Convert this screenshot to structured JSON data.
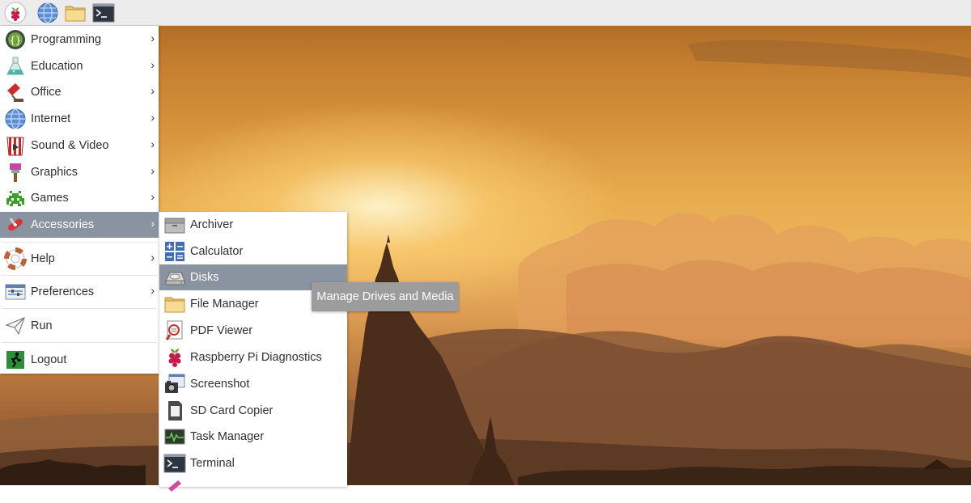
{
  "panel": {
    "buttons": [
      {
        "name": "raspberry-menu-button",
        "icon": "raspberry-icon"
      },
      {
        "name": "web-browser-button",
        "icon": "globe-icon"
      },
      {
        "name": "file-manager-button",
        "icon": "folder-icon"
      },
      {
        "name": "terminal-button",
        "icon": "terminal-icon"
      }
    ]
  },
  "main_menu": {
    "items": [
      {
        "label": "Programming",
        "icon": "programming-icon",
        "has_submenu": true
      },
      {
        "label": "Education",
        "icon": "education-flask-icon",
        "has_submenu": true
      },
      {
        "label": "Office",
        "icon": "office-icon",
        "has_submenu": true
      },
      {
        "label": "Internet",
        "icon": "globe-icon",
        "has_submenu": true
      },
      {
        "label": "Sound & Video",
        "icon": "sound-video-icon",
        "has_submenu": true
      },
      {
        "label": "Graphics",
        "icon": "paintbrush-icon",
        "has_submenu": true
      },
      {
        "label": "Games",
        "icon": "space-invader-icon",
        "has_submenu": true
      },
      {
        "label": "Accessories",
        "icon": "swiss-knife-icon",
        "has_submenu": true,
        "active": true
      },
      {
        "label": "Help",
        "icon": "lifebuoy-icon",
        "has_submenu": true
      },
      {
        "label": "Preferences",
        "icon": "preferences-icon",
        "has_submenu": true
      },
      {
        "label": "Run",
        "icon": "paper-plane-icon",
        "has_submenu": false
      },
      {
        "label": "Logout",
        "icon": "exit-running-man-icon",
        "has_submenu": false
      }
    ],
    "submenu_arrow": "›"
  },
  "accessories_menu": {
    "items": [
      {
        "label": "Archiver",
        "icon": "archive-box-icon"
      },
      {
        "label": "Calculator",
        "icon": "calculator-icon"
      },
      {
        "label": "Disks",
        "icon": "disk-drive-icon",
        "active": true
      },
      {
        "label": "File Manager",
        "icon": "folder-icon"
      },
      {
        "label": "PDF Viewer",
        "icon": "pdf-magnifier-icon"
      },
      {
        "label": "Raspberry Pi Diagnostics",
        "icon": "raspberry-icon"
      },
      {
        "label": "Screenshot",
        "icon": "camera-icon"
      },
      {
        "label": "SD Card Copier",
        "icon": "sd-card-icon"
      },
      {
        "label": "Task Manager",
        "icon": "task-manager-icon"
      },
      {
        "label": "Terminal",
        "icon": "terminal-icon"
      }
    ]
  },
  "tooltip": {
    "text": "Manage Drives and Media"
  },
  "colors": {
    "panel_bg": "#ececec",
    "menu_bg": "#ffffff",
    "highlight": "#8994a0",
    "tooltip_bg": "#9c9c9c",
    "text": "#303030"
  }
}
